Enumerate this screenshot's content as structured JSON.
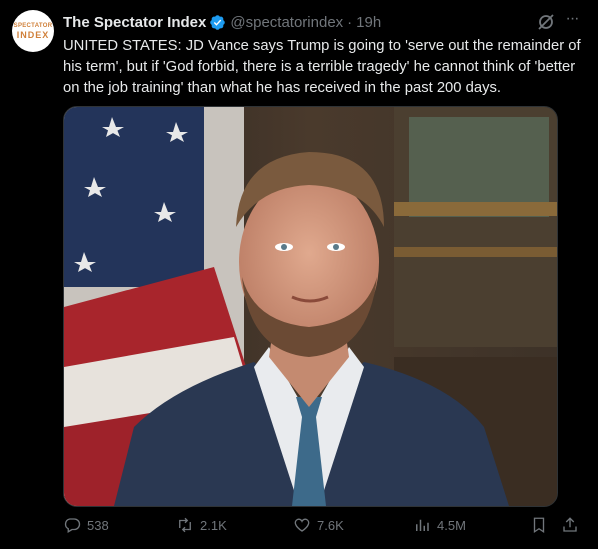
{
  "author": {
    "avatar_line1": "SPECTATOR",
    "avatar_line2": "INDEX",
    "name": "The Spectator Index",
    "handle": "@spectatorindex",
    "time": "19h"
  },
  "tweet": {
    "text": "UNITED STATES: JD Vance says Trump is going to 'serve out the remainder of his term', but if 'God forbid, there is a terrible tragedy' he cannot think of 'better on the job training' than what he has received in the past 200 days."
  },
  "actions": {
    "replies": "538",
    "reposts": "2.1K",
    "likes": "7.6K",
    "views": "4.5M"
  },
  "colors": {
    "verified": "#1d9bf0",
    "muted": "#71767b",
    "text": "#e7e9ea",
    "background": "#000000"
  },
  "icons": [
    "verified-badge-icon",
    "grok-icon",
    "more-icon",
    "reply-icon",
    "repost-icon",
    "like-icon",
    "views-icon",
    "bookmark-icon",
    "share-icon"
  ]
}
